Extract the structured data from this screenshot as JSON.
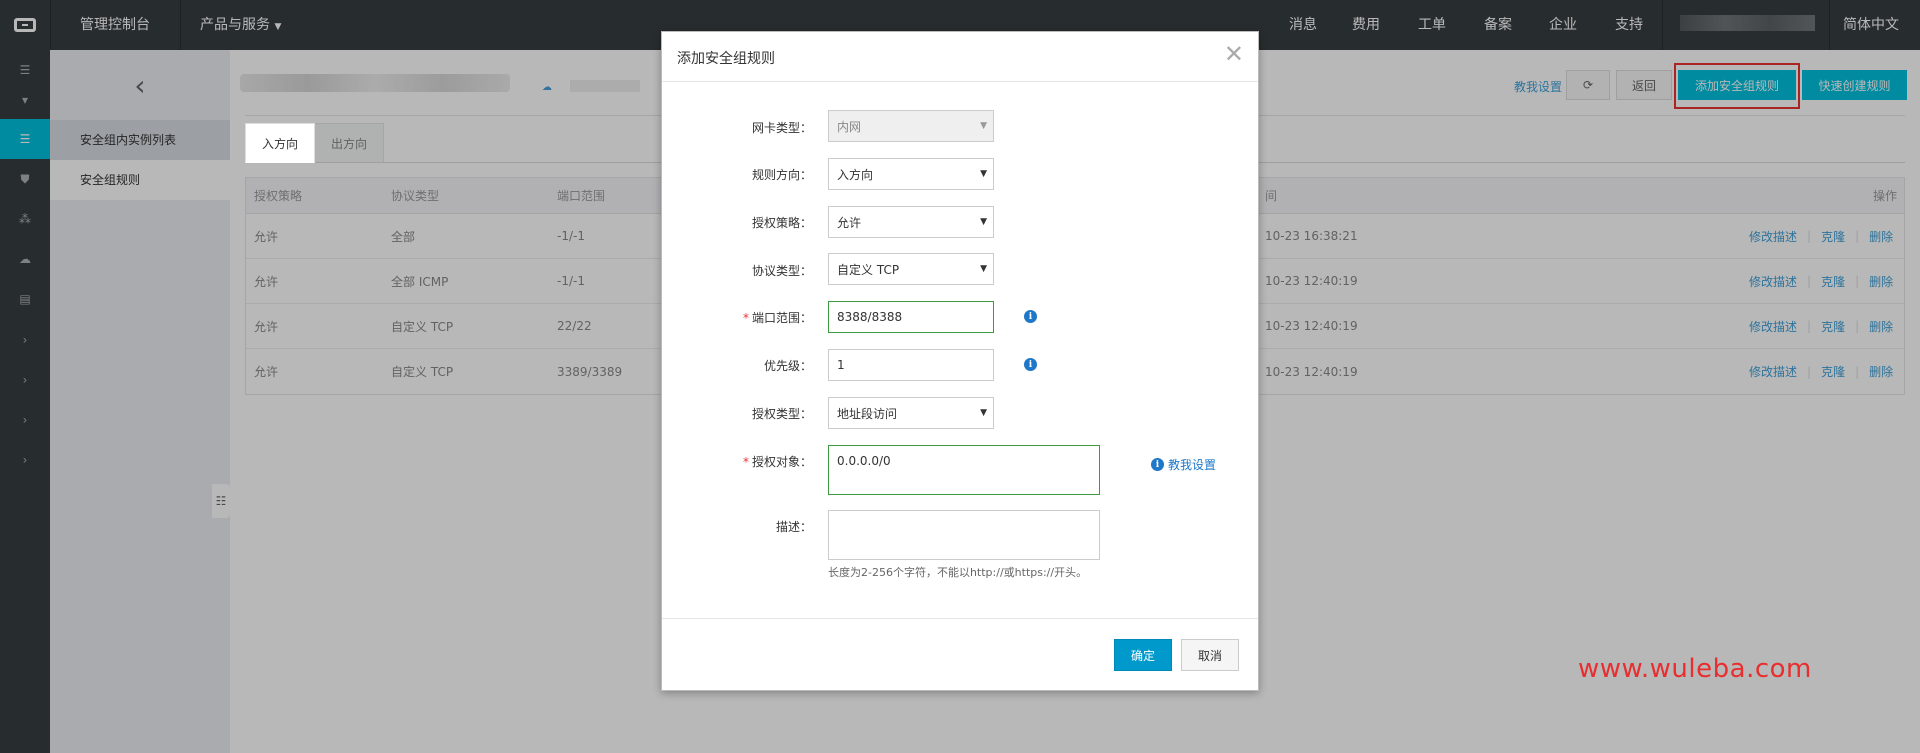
{
  "topbar": {
    "console": "管理控制台",
    "products": "产品与服务",
    "right_items": [
      "消息",
      "费用",
      "工单",
      "备案",
      "企业",
      "支持"
    ],
    "language": "简体中文"
  },
  "rail": {
    "icons": [
      "menu-icon",
      "caret-down-icon",
      "list-icon",
      "shield-icon",
      "network-icon",
      "cloud-icon",
      "database-icon",
      "chevron-right-icon",
      "chevron-right-icon",
      "chevron-right-icon",
      "chevron-right-icon"
    ]
  },
  "sidebar": {
    "back": "‹",
    "items": [
      {
        "label": "安全组内实例列表"
      },
      {
        "label": "安全组规则"
      }
    ]
  },
  "toolbar": {
    "help": "教我设置",
    "refresh": "⟳",
    "back": "返回",
    "add_rule": "添加安全组规则",
    "quick_create": "快速创建规则"
  },
  "tabs": [
    "入方向",
    "出方向"
  ],
  "table": {
    "headers": [
      "授权策略",
      "协议类型",
      "端口范围",
      "间",
      "操作"
    ],
    "rows": [
      {
        "policy": "允许",
        "protocol": "全部",
        "port": "-1/-1",
        "time": "10-23 16:38:21"
      },
      {
        "policy": "允许",
        "protocol": "全部 ICMP",
        "port": "-1/-1",
        "time": "10-23 12:40:19"
      },
      {
        "policy": "允许",
        "protocol": "自定义 TCP",
        "port": "22/22",
        "time": "10-23 12:40:19"
      },
      {
        "policy": "允许",
        "protocol": "自定义 TCP",
        "port": "3389/3389",
        "time": "10-23 12:40:19"
      }
    ],
    "actions": [
      "修改描述",
      "克隆",
      "删除"
    ]
  },
  "modal": {
    "title": "添加安全组规则",
    "fields": {
      "nic_type": {
        "label": "网卡类型：",
        "value": "内网"
      },
      "direction": {
        "label": "规则方向：",
        "value": "入方向"
      },
      "policy": {
        "label": "授权策略：",
        "value": "允许"
      },
      "protocol": {
        "label": "协议类型：",
        "value": "自定义 TCP"
      },
      "port_range": {
        "label": "端口范围：",
        "value": "8388/8388"
      },
      "priority": {
        "label": "优先级：",
        "value": "1"
      },
      "auth_type": {
        "label": "授权类型：",
        "value": "地址段访问"
      },
      "auth_object": {
        "label": "授权对象：",
        "value": "0.0.0.0/0"
      },
      "description": {
        "label": "描述：",
        "value": ""
      }
    },
    "required_mark": "*",
    "help_link": "教我设置",
    "desc_hint": "长度为2-256个字符，不能以http://或https://开头。",
    "ok": "确定",
    "cancel": "取消"
  },
  "watermark": "www.wuleba.com"
}
